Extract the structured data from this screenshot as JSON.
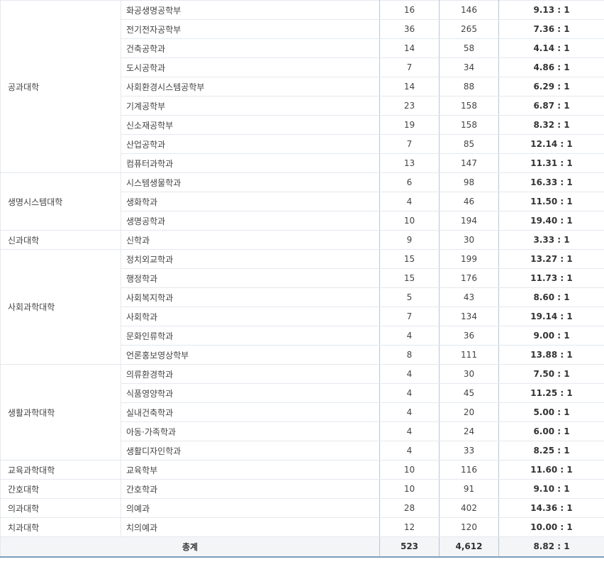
{
  "groups": [
    {
      "college": "공과대학",
      "rows": [
        {
          "dept": "화공생명공학부",
          "quota": "16",
          "applicants": "146",
          "ratio": "9.13 : 1"
        },
        {
          "dept": "전기전자공학부",
          "quota": "36",
          "applicants": "265",
          "ratio": "7.36 : 1"
        },
        {
          "dept": "건축공학과",
          "quota": "14",
          "applicants": "58",
          "ratio": "4.14 : 1"
        },
        {
          "dept": "도시공학과",
          "quota": "7",
          "applicants": "34",
          "ratio": "4.86 : 1"
        },
        {
          "dept": "사회환경시스템공학부",
          "quota": "14",
          "applicants": "88",
          "ratio": "6.29 : 1"
        },
        {
          "dept": "기계공학부",
          "quota": "23",
          "applicants": "158",
          "ratio": "6.87 : 1"
        },
        {
          "dept": "신소재공학부",
          "quota": "19",
          "applicants": "158",
          "ratio": "8.32 : 1"
        },
        {
          "dept": "산업공학과",
          "quota": "7",
          "applicants": "85",
          "ratio": "12.14 : 1"
        },
        {
          "dept": "컴퓨터과학과",
          "quota": "13",
          "applicants": "147",
          "ratio": "11.31 : 1"
        }
      ]
    },
    {
      "college": "생명시스템대학",
      "rows": [
        {
          "dept": "시스템생물학과",
          "quota": "6",
          "applicants": "98",
          "ratio": "16.33 : 1"
        },
        {
          "dept": "생화학과",
          "quota": "4",
          "applicants": "46",
          "ratio": "11.50 : 1"
        },
        {
          "dept": "생명공학과",
          "quota": "10",
          "applicants": "194",
          "ratio": "19.40 : 1"
        }
      ]
    },
    {
      "college": "신과대학",
      "rows": [
        {
          "dept": "신학과",
          "quota": "9",
          "applicants": "30",
          "ratio": "3.33 : 1"
        }
      ]
    },
    {
      "college": "사회과학대학",
      "rows": [
        {
          "dept": "정치외교학과",
          "quota": "15",
          "applicants": "199",
          "ratio": "13.27 : 1"
        },
        {
          "dept": "행정학과",
          "quota": "15",
          "applicants": "176",
          "ratio": "11.73 : 1"
        },
        {
          "dept": "사회복지학과",
          "quota": "5",
          "applicants": "43",
          "ratio": "8.60 : 1"
        },
        {
          "dept": "사회학과",
          "quota": "7",
          "applicants": "134",
          "ratio": "19.14 : 1"
        },
        {
          "dept": "문화인류학과",
          "quota": "4",
          "applicants": "36",
          "ratio": "9.00 : 1"
        },
        {
          "dept": "언론홍보영상학부",
          "quota": "8",
          "applicants": "111",
          "ratio": "13.88 : 1"
        }
      ]
    },
    {
      "college": "생활과학대학",
      "rows": [
        {
          "dept": "의류환경학과",
          "quota": "4",
          "applicants": "30",
          "ratio": "7.50 : 1"
        },
        {
          "dept": "식품영양학과",
          "quota": "4",
          "applicants": "45",
          "ratio": "11.25 : 1"
        },
        {
          "dept": "실내건축학과",
          "quota": "4",
          "applicants": "20",
          "ratio": "5.00 : 1"
        },
        {
          "dept": "아동·가족학과",
          "quota": "4",
          "applicants": "24",
          "ratio": "6.00 : 1"
        },
        {
          "dept": "생활디자인학과",
          "quota": "4",
          "applicants": "33",
          "ratio": "8.25 : 1"
        }
      ]
    },
    {
      "college": "교육과학대학",
      "rows": [
        {
          "dept": "교육학부",
          "quota": "10",
          "applicants": "116",
          "ratio": "11.60 : 1"
        }
      ]
    },
    {
      "college": "간호대학",
      "rows": [
        {
          "dept": "간호학과",
          "quota": "10",
          "applicants": "91",
          "ratio": "9.10 : 1"
        }
      ]
    },
    {
      "college": "의과대학",
      "rows": [
        {
          "dept": "의예과",
          "quota": "28",
          "applicants": "402",
          "ratio": "14.36 : 1"
        }
      ]
    },
    {
      "college": "치과대학",
      "rows": [
        {
          "dept": "치의예과",
          "quota": "12",
          "applicants": "120",
          "ratio": "10.00 : 1"
        }
      ]
    }
  ],
  "total": {
    "label": "총계",
    "quota": "523",
    "applicants": "4,612",
    "ratio": "8.82 : 1"
  }
}
